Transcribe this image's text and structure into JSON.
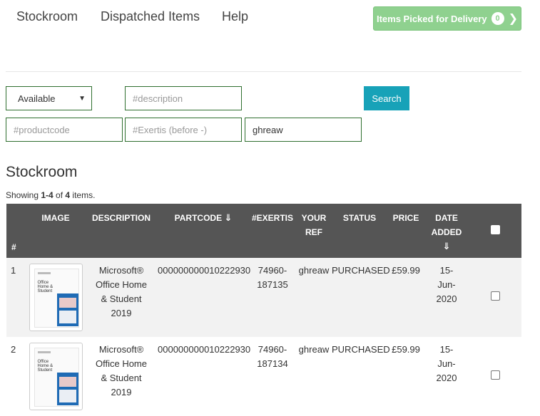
{
  "nav": {
    "items": [
      "Stockroom",
      "Dispatched Items",
      "Help"
    ],
    "picked_label": "Items Picked for Delivery",
    "picked_count": "0",
    "picked_icon": "chevron-right-icon"
  },
  "filters": {
    "status_value": "Available",
    "description_placeholder": "#description",
    "productcode_placeholder": "#productcode",
    "exertis_placeholder": "#Exertis (before -)",
    "ref_value": "ghreaw",
    "search_label": "Search"
  },
  "section": {
    "title": "Stockroom",
    "summary_prefix": "Showing ",
    "summary_range": "1-4",
    "summary_of": " of ",
    "summary_total": "4",
    "summary_suffix": " items."
  },
  "table": {
    "headers": {
      "num": "#",
      "image": "IMAGE",
      "description": "DESCRIPTION",
      "partcode": "PARTCODE",
      "exertis": "#EXERTIS",
      "ref_line1": "YOUR",
      "ref_line2": "REF",
      "status": "STATUS",
      "price": "PRICE",
      "date_line1": "DATE",
      "date_line2": "ADDED"
    },
    "rows": [
      {
        "num": "1",
        "desc_line1": "Microsoft®",
        "desc_line2": "Office Home",
        "desc_line3": "& Student",
        "desc_line4": "2019",
        "partcode": "000000000010222930",
        "exertis_line1": "74960-",
        "exertis_line2": "187135",
        "ref": "ghreaw",
        "status": "PURCHASED",
        "price": "£59.99",
        "date_line1": "15-",
        "date_line2": "Jun-",
        "date_line3": "2020",
        "thumb_text_1": "Office",
        "thumb_text_2": "Home &",
        "thumb_text_3": "Student"
      },
      {
        "num": "2",
        "desc_line1": "Microsoft®",
        "desc_line2": "Office Home",
        "desc_line3": "& Student",
        "desc_line4": "2019",
        "partcode": "000000000010222930",
        "exertis_line1": "74960-",
        "exertis_line2": "187134",
        "ref": "ghreaw",
        "status": "PURCHASED",
        "price": "£59.99",
        "date_line1": "15-",
        "date_line2": "Jun-",
        "date_line3": "2020",
        "thumb_text_1": "Office",
        "thumb_text_2": "Home &",
        "thumb_text_3": "Student"
      }
    ]
  }
}
